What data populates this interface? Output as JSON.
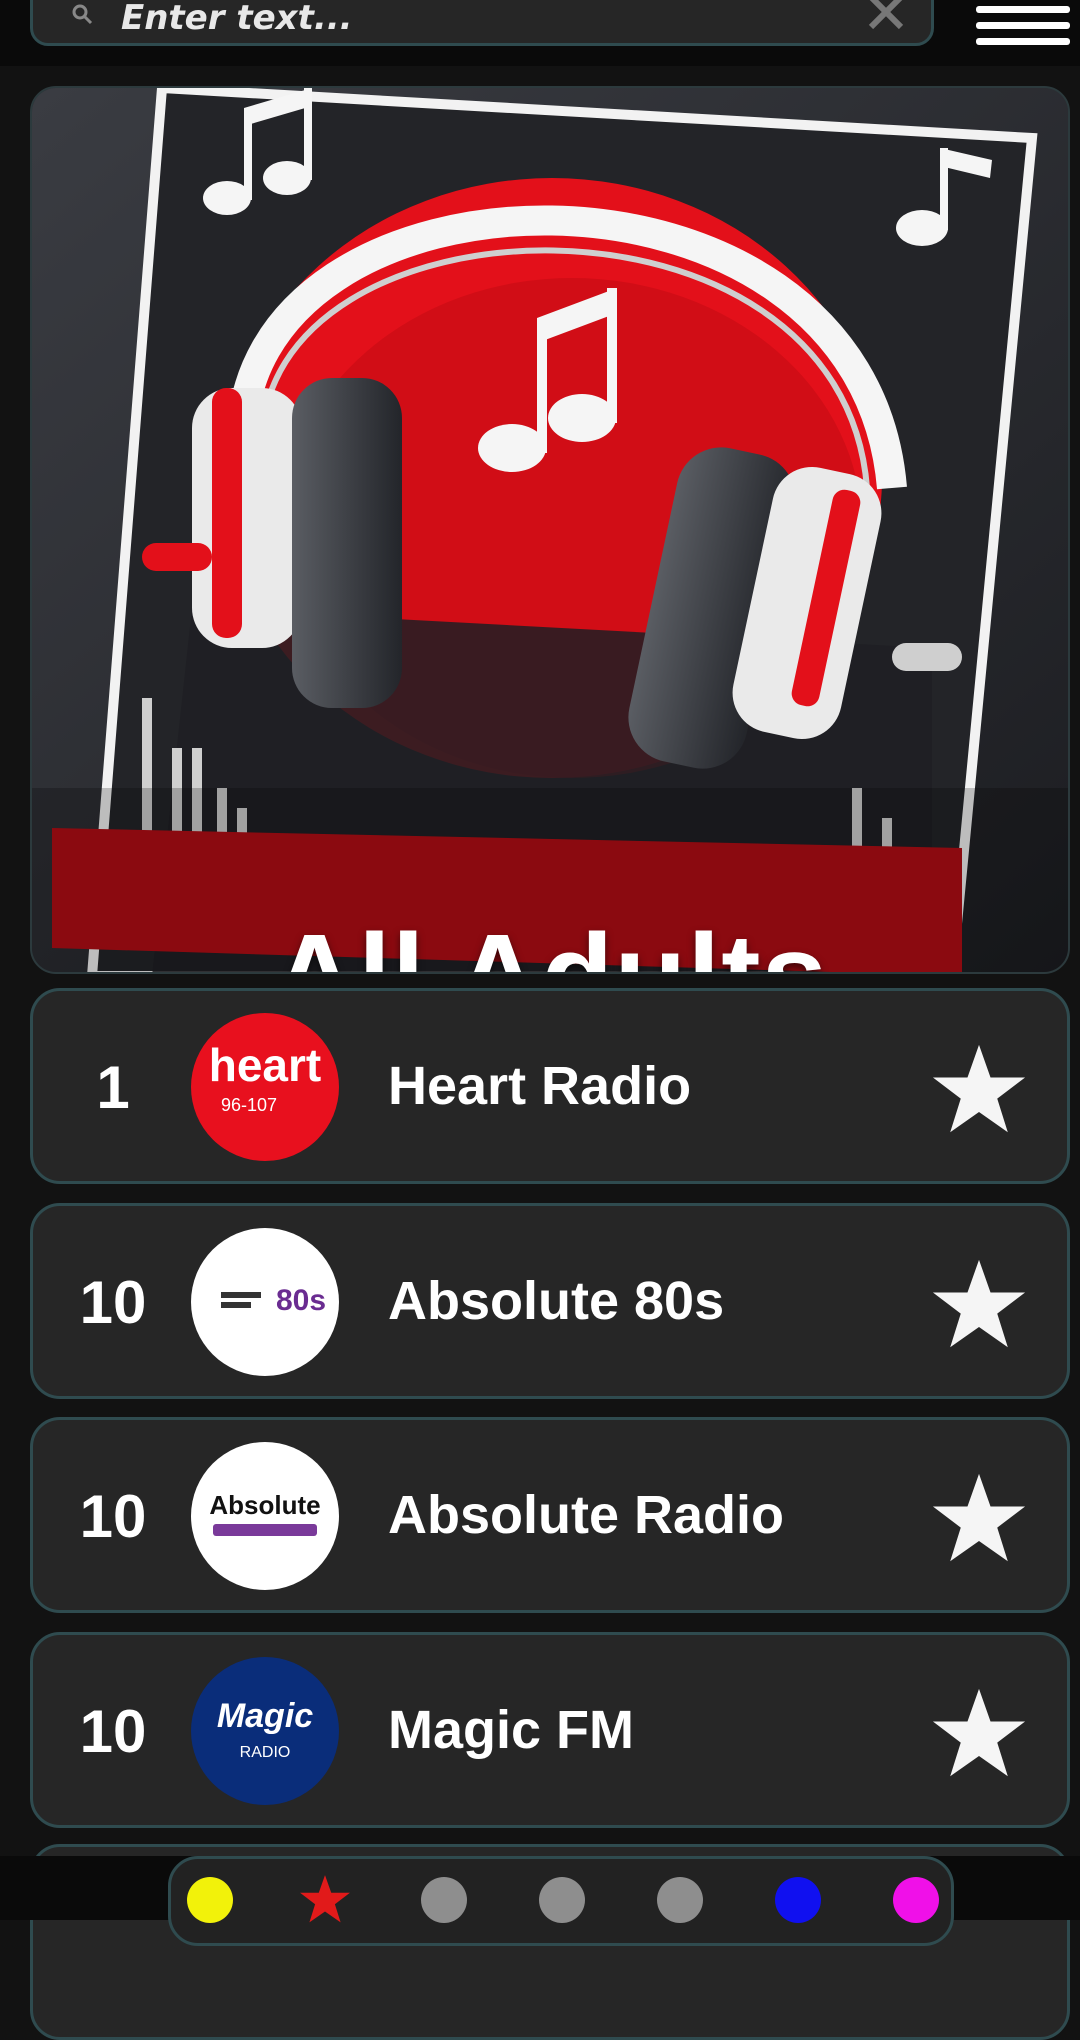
{
  "search": {
    "placeholder": "Enter text..."
  },
  "hero": {
    "title": "All Adults"
  },
  "stations": [
    {
      "rank": "1",
      "name": "Heart Radio",
      "logo_text": "heart",
      "logo_sub": "96-107",
      "logo_bg": "#e8101e",
      "logo_fg": "#ffffff"
    },
    {
      "rank": "10",
      "name": "Absolute 80s",
      "logo_text": "80s",
      "logo_sub": "",
      "logo_bg": "#ffffff",
      "logo_fg": "#6a2c91"
    },
    {
      "rank": "10",
      "name": "Absolute Radio",
      "logo_text": "Absolute",
      "logo_sub": "",
      "logo_bg": "#ffffff",
      "logo_fg": "#111111"
    },
    {
      "rank": "10",
      "name": "Magic FM",
      "logo_text": "Magic",
      "logo_sub": "RADIO",
      "logo_bg": "#0a2d7a",
      "logo_fg": "#ffffff"
    }
  ],
  "bottom_dots": [
    {
      "icon": "yellow-dot",
      "color": "#f2f20a"
    },
    {
      "icon": "star-icon",
      "color": "#e11a1a"
    },
    {
      "icon": "gray-dot",
      "color": "#8e8e8e"
    },
    {
      "icon": "gray-dot",
      "color": "#8e8e8e"
    },
    {
      "icon": "gray-dot",
      "color": "#8e8e8e"
    },
    {
      "icon": "blue-dot",
      "color": "#1010f0"
    },
    {
      "icon": "magenta-dot",
      "color": "#f010e8"
    }
  ]
}
